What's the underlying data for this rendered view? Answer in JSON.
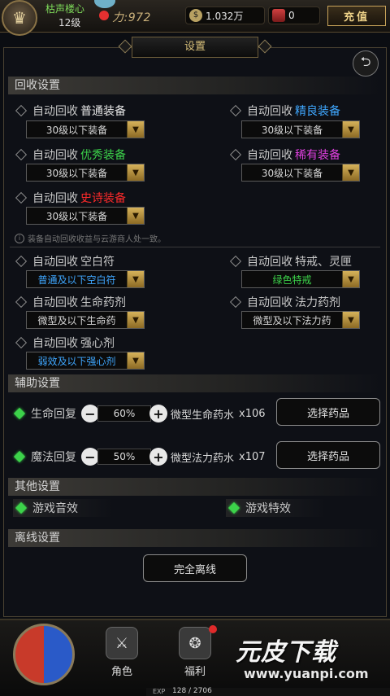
{
  "player": {
    "name": "枯声楼心",
    "level": "12级",
    "power": "力:972",
    "money": "1.032万",
    "gems": "0",
    "recharge": "充值"
  },
  "panel": {
    "title": "设置"
  },
  "recycle": {
    "header": "回收设置",
    "prefix": "自动回收",
    "equip": [
      {
        "kind": "普通装备",
        "color": "#e6e6e6",
        "value": "30级以下装备"
      },
      {
        "kind": "精良装备",
        "color": "#3fa7ff",
        "value": "30级以下装备"
      },
      {
        "kind": "优秀装备",
        "color": "#3cd24a",
        "value": "30级以下装备"
      },
      {
        "kind": "稀有装备",
        "color": "#e040e0",
        "value": "30级以下装备"
      },
      {
        "kind": "史诗装备",
        "color": "#ff2a2a",
        "value": "30级以下装备"
      }
    ],
    "note": "装备自动回收收益与云游商人处一致。",
    "items": [
      {
        "kind": "空白符",
        "value": "普通及以下空白符",
        "value_color": "#3fa7ff"
      },
      {
        "kind": "特戒、灵匣",
        "value": "绿色特戒",
        "value_color": "#3cd24a"
      },
      {
        "kind": "生命药剂",
        "value": "微型及以下生命药",
        "value_color": "#d8d8d8"
      },
      {
        "kind": "法力药剂",
        "value": "微型及以下法力药",
        "value_color": "#d8d8d8"
      },
      {
        "kind": "强心剂",
        "value": "弱效及以下强心剂",
        "value_color": "#3fa7ff"
      }
    ]
  },
  "aux": {
    "header": "辅助设置",
    "rows": [
      {
        "label": "生命回复",
        "value": "60%",
        "potion": "微型生命药水",
        "count": "x106",
        "button": "选择药品"
      },
      {
        "label": "魔法回复",
        "value": "50%",
        "potion": "微型法力药水",
        "count": "x107",
        "button": "选择药品"
      }
    ]
  },
  "other": {
    "header": "其他设置",
    "sound": "游戏音效",
    "effects": "游戏特效"
  },
  "offline": {
    "header": "离线设置",
    "button": "完全离线"
  },
  "nav": {
    "role": "角色",
    "welfare": "福利"
  },
  "exp": {
    "label": "EXP",
    "value": "128 / 2706"
  },
  "watermark": {
    "text": "元皮下载",
    "url": "www.yuanpi.com"
  },
  "icons": [
    "back-arrow-icon",
    "minus-icon",
    "plus-icon",
    "dropdown-arrow-icon",
    "info-icon",
    "gem-diamond-icon"
  ]
}
